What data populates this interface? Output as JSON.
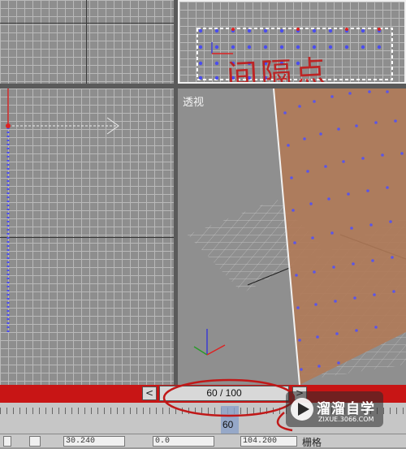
{
  "viewports": {
    "perspective_label": "透视"
  },
  "timeline": {
    "frame_display": "60 / 100",
    "prev_label": "<",
    "next_label": ">",
    "ruler_frame": "60"
  },
  "statusbar": {
    "x_value": "30.240",
    "y_value": "0.0",
    "z_value": "104.200",
    "grid_label": "栅格"
  },
  "annotation": {
    "text": "间隔点"
  },
  "watermark": {
    "title": "溜溜自学",
    "subtitle": "ZIXUE.3066.COM"
  },
  "colors": {
    "timeline_red": "#c81515",
    "annotation_red": "#c01818",
    "point_blue": "#4a4cf0",
    "plane_orange": "#b07a58"
  }
}
